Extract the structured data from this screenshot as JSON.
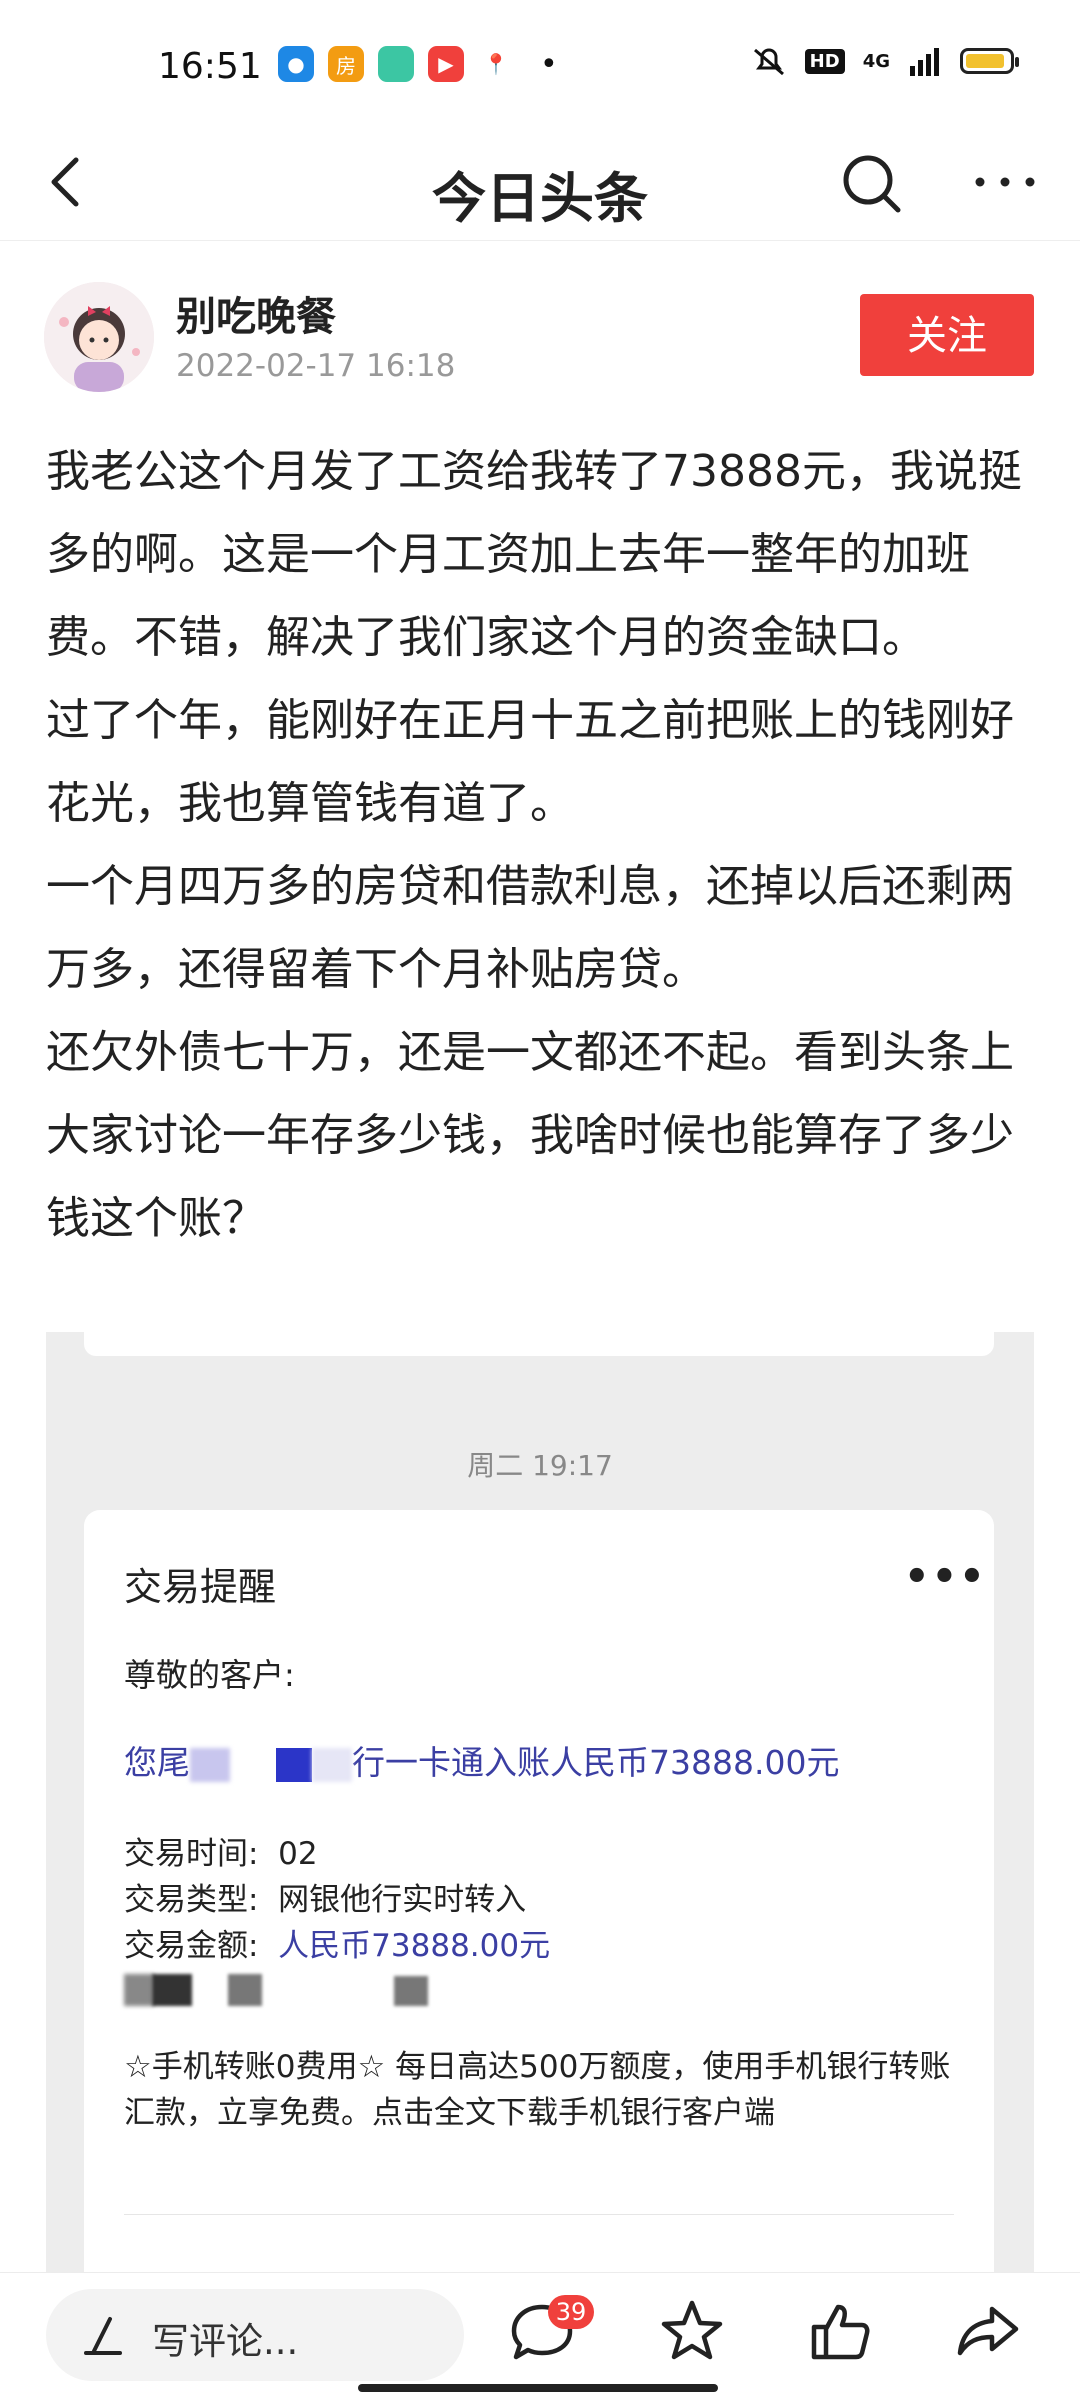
{
  "status_bar": {
    "time": "16:51",
    "network": "4G",
    "hd_label": "HD",
    "battery_level": 0.9,
    "apps": [
      {
        "icon": "dot-app-icon",
        "color": "#1e88e5",
        "glyph": "●"
      },
      {
        "icon": "fang-app-icon",
        "color": "#f39c12",
        "glyph": "房"
      },
      {
        "icon": "green-app-icon",
        "color": "#3cc6a3",
        "glyph": ""
      },
      {
        "icon": "video-app-icon",
        "color": "#f0403c",
        "glyph": "▶"
      },
      {
        "icon": "map-pin-app-icon",
        "color": "#ffffff",
        "glyph": "📍"
      }
    ]
  },
  "nav": {
    "title": "今日头条"
  },
  "author": {
    "name": "别吃晚餐",
    "date": "2022-02-17 16:18",
    "follow_label": "关注"
  },
  "article": {
    "paragraphs": [
      "我老公这个月发了工资给我转了73888元，我说挺多的啊。这是一个月工资加上去年一整年的加班费。不错，解决了我们家这个月的资金缺口。",
      "过了个年，能刚好在正月十五之前把账上的钱刚好花光，我也算管钱有道了。",
      "一个月四万多的房贷和借款利息，还掉以后还剩两万多，还得留着下个月补贴房贷。",
      "还欠外债七十万，还是一文都还不起。看到头条上大家讨论一年存多少钱，我啥时候也能算存了多少钱这个账？"
    ]
  },
  "screenshot": {
    "time": "周二 19:17",
    "card_title": "交易提醒",
    "greeting": "尊敬的客户:",
    "line_prefix": "您尾",
    "line_suffix": "行一卡通入账人民币73888.00元",
    "details": [
      {
        "label": "交易时间:",
        "value": "02",
        "blue": false
      },
      {
        "label": "交易类型:",
        "value": "网银他行实时转入",
        "blue": false
      },
      {
        "label": "交易金额:",
        "value": "人民币73888.00元",
        "blue": true
      }
    ],
    "promo": "☆手机转账0费用☆  每日高达500万额度，使用手机银行转账汇款，立享免费。点击全文下载手机银行客户端"
  },
  "bottom_bar": {
    "comment_placeholder": "写评论...",
    "comment_count": "39"
  }
}
